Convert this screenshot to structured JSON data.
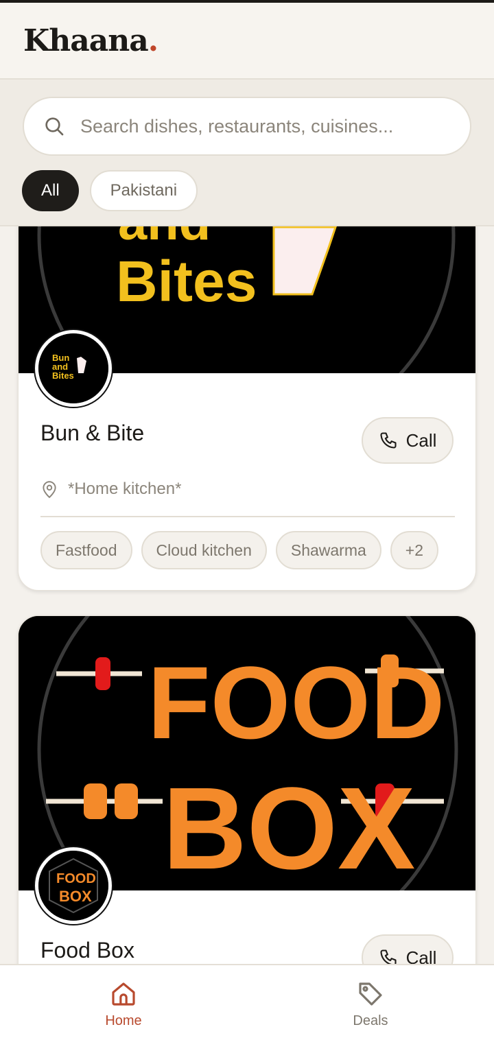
{
  "app": {
    "name": "Khaana",
    "name_dot": "."
  },
  "search": {
    "placeholder": "Search dishes, restaurants, cuisines...",
    "value": ""
  },
  "filters": [
    {
      "label": "All",
      "active": true
    },
    {
      "label": "Pakistani",
      "active": false
    }
  ],
  "restaurants": [
    {
      "name": "Bun & Bite",
      "call_label": "Call",
      "location": "*Home kitchen*",
      "tags": [
        "Fastfood",
        "Cloud kitchen",
        "Shawarma",
        "+2"
      ],
      "logo_text": [
        "Bun",
        "and",
        "Bites"
      ],
      "banner_text": [
        "and",
        "Bites"
      ],
      "colors": {
        "logo_text": "#f2c01e",
        "banner_bg": "#000000"
      }
    },
    {
      "name": "Food Box",
      "call_label": "Call",
      "logo_text": [
        "FOOD",
        "BOX"
      ],
      "banner_text": [
        "FOOD",
        "BOX"
      ],
      "colors": {
        "logo_text": "#f48a2a",
        "banner_bg": "#000000"
      }
    }
  ],
  "bottom_nav": [
    {
      "label": "Home",
      "icon": "home-icon",
      "active": true
    },
    {
      "label": "Deals",
      "icon": "tag-icon",
      "active": false
    }
  ],
  "colors": {
    "background": "#f4f1ec",
    "accent": "#b84a2e",
    "logo_dot": "#c0462a",
    "chip_active": "#1f1d1a",
    "text_primary": "#1c1a17",
    "text_muted": "#8b857b"
  }
}
